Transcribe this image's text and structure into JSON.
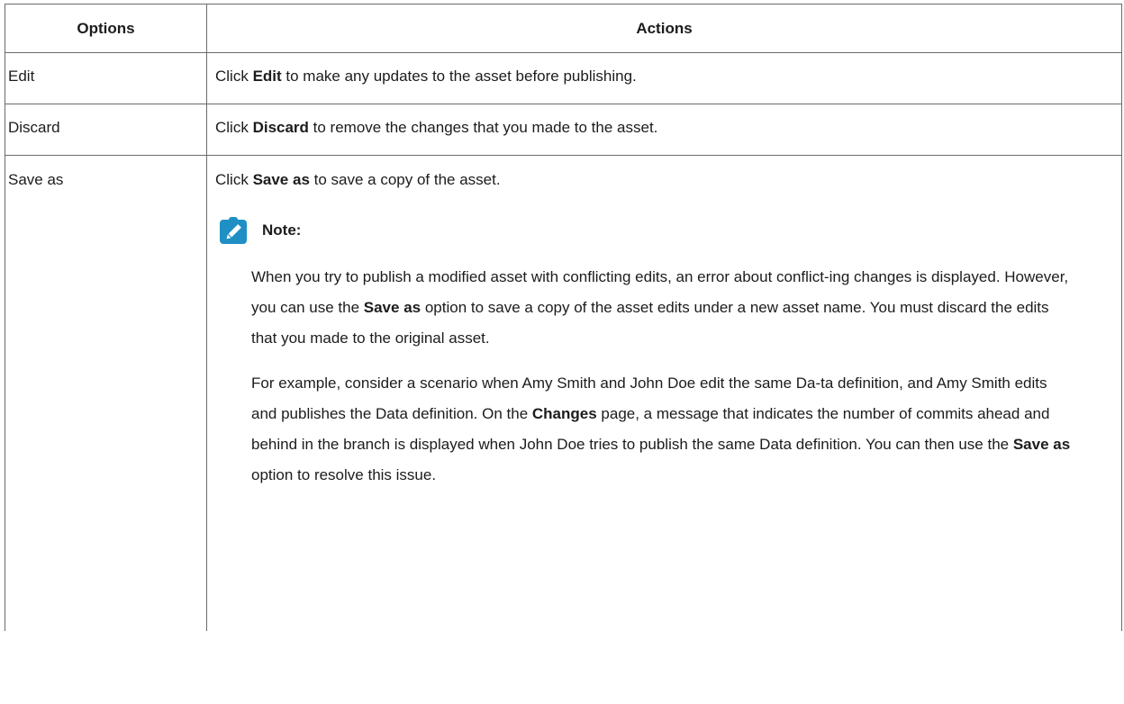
{
  "table": {
    "headers": {
      "options": "Options",
      "actions": "Actions"
    },
    "rows": [
      {
        "option": "Edit",
        "action": {
          "pre": "Click ",
          "bold": "Edit",
          "post": " to make any updates to the asset before publishing."
        }
      },
      {
        "option": "Discard",
        "action": {
          "pre": "Click ",
          "bold": "Discard",
          "post": " to remove the changes that you made to the asset."
        }
      },
      {
        "option": "Save as",
        "action": {
          "pre": "Click ",
          "bold": "Save as",
          "post": " to save a copy of the asset."
        },
        "note": {
          "icon": "pencil-note-icon",
          "icon_color": "#1f8fc4",
          "title": "Note:",
          "p1": {
            "t1": "When you try to publish a modified asset with conflicting edits, an error about conflict-ing changes is displayed. However, you can use the ",
            "b1": "Save as",
            "t2": " option to save a copy of the asset edits under a new asset name. You must discard the edits that you made to the original asset."
          },
          "p2": {
            "t1": "For example, consider a scenario when Amy Smith and John Doe edit the same Da-ta definition, and Amy Smith edits and publishes the Data definition. On the ",
            "b1": "Changes",
            "t2": " page, a message that indicates the number of commits ahead and behind in the branch is displayed when John Doe tries to publish the same Data definition. You can then use the ",
            "b2": "Save as",
            "t3": " option to resolve this issue."
          }
        }
      }
    ]
  }
}
